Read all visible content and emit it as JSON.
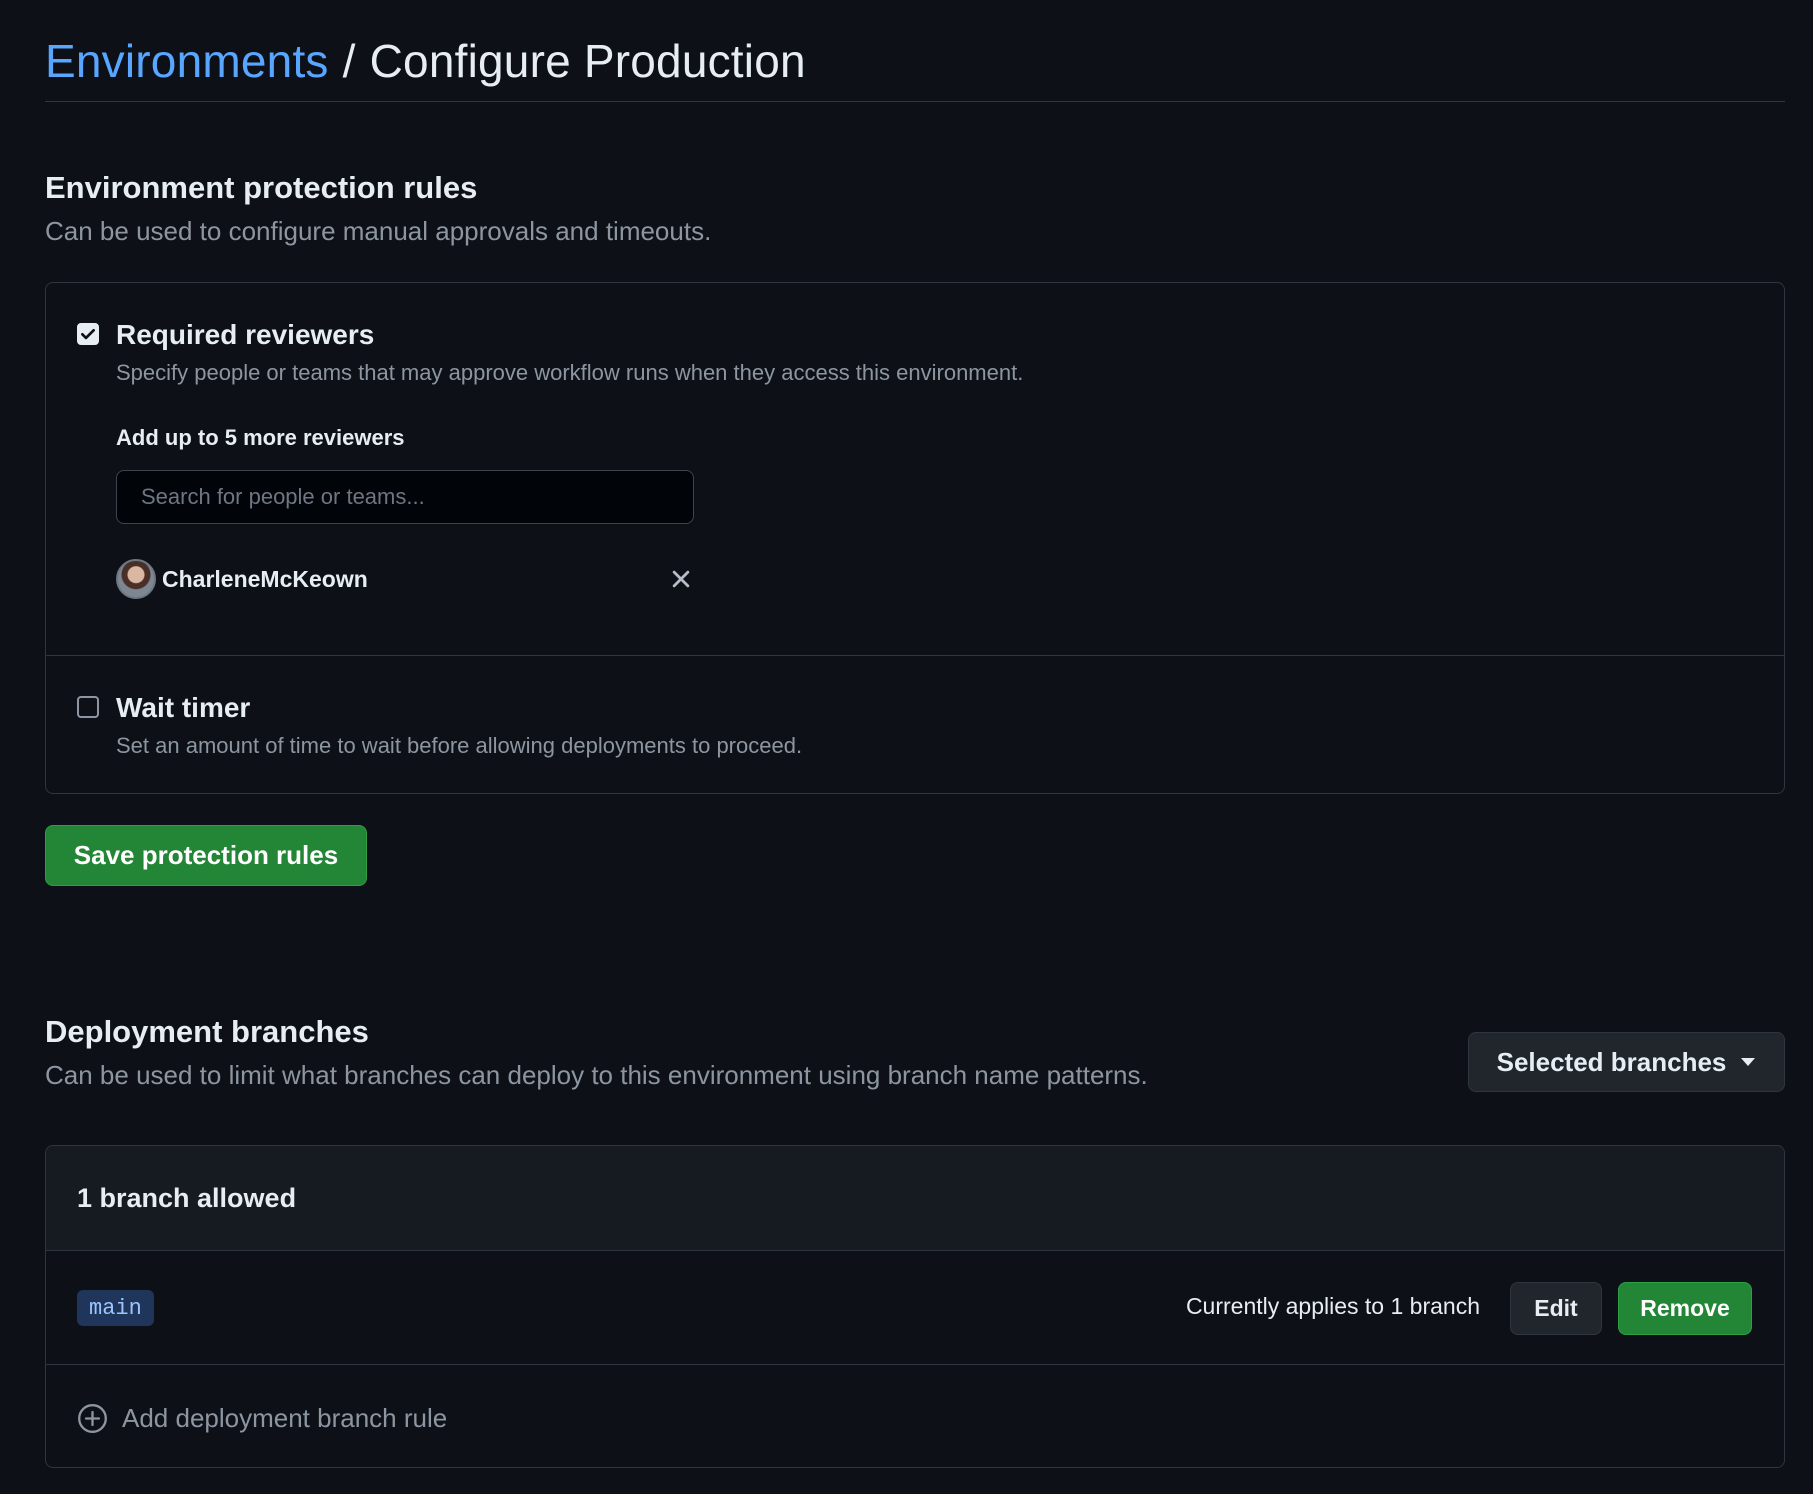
{
  "breadcrumb": {
    "parent": "Environments",
    "separator": "/",
    "current": "Configure Production"
  },
  "protection": {
    "title": "Environment protection rules",
    "description": "Can be used to configure manual approvals and timeouts.",
    "required_reviewers": {
      "checked": true,
      "label": "Required reviewers",
      "description": "Specify people or teams that may approve workflow runs when they access this environment.",
      "add_label": "Add up to 5 more reviewers",
      "search_placeholder": "Search for people or teams...",
      "reviewers": [
        {
          "name": "CharleneMcKeown"
        }
      ]
    },
    "wait_timer": {
      "checked": false,
      "label": "Wait timer",
      "description": "Set an amount of time to wait before allowing deployments to proceed."
    },
    "save_label": "Save protection rules"
  },
  "deployment": {
    "title": "Deployment branches",
    "description": "Can be used to limit what branches can deploy to this environment using branch name patterns.",
    "policy_label": "Selected branches",
    "allowed_count_label": "1 branch allowed",
    "rules": [
      {
        "pattern": "main",
        "applies_text": "Currently applies to 1 branch",
        "edit_label": "Edit",
        "remove_label": "Remove"
      }
    ],
    "add_rule_label": "Add deployment branch rule"
  },
  "icons": {
    "checkbox_checked": "check-icon",
    "remove_reviewer": "x-icon",
    "dropdown": "triangle-down-icon",
    "add_rule": "plus-circle-icon"
  },
  "colors": {
    "background": "#0d1117",
    "link": "#58a6ff",
    "primary_button": "#238636",
    "muted_text": "#8d96a0",
    "border": "#30363d"
  }
}
